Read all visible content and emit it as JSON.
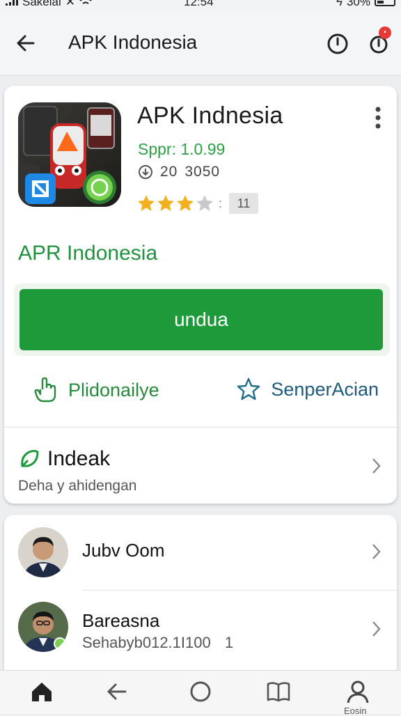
{
  "status_bar": {
    "carrier": "Sakelal",
    "time": "12:54",
    "battery": "30%"
  },
  "app_bar": {
    "title": "APK Indonesia"
  },
  "app": {
    "name": "APK Indnesia",
    "version": "Sppr: 1.0.99",
    "downloads_prefix": "20",
    "downloads_value": "3050",
    "rating_stars": 3.5,
    "rating_box": "11",
    "publisher": "APR Indonesia",
    "download_label": "undua",
    "action_left": "Plidonailye",
    "action_right": "SenperAcian",
    "info_title": "Indeak",
    "info_subtitle": "Deha y ahidengan"
  },
  "list": [
    {
      "name": "Jubv Oom",
      "sub": ""
    },
    {
      "name": "Bareasna",
      "sub": "Sehabyb012.1I100",
      "sub_suffix": "1"
    }
  ],
  "bottom_nav": {
    "profile_label": "Eosin"
  },
  "colors": {
    "brand_green": "#1f9a3a",
    "publisher_green": "#22913f",
    "star_gold": "#f2b01e",
    "right_action_blue": "#1f5a7a"
  }
}
